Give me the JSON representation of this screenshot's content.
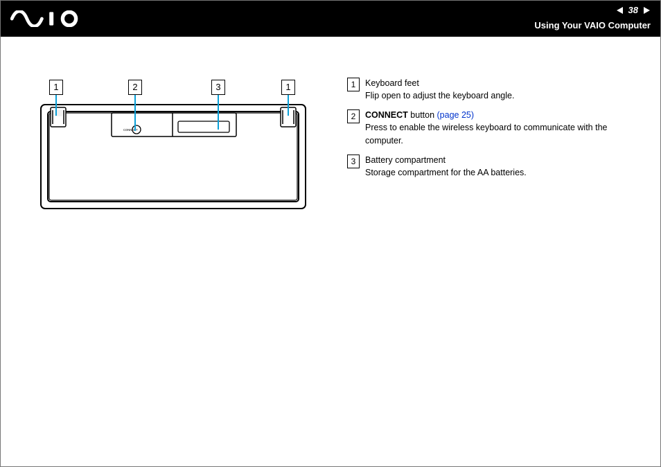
{
  "header": {
    "page_number": "38",
    "section_title": "Using Your VAIO Computer"
  },
  "callouts": {
    "c1": "1",
    "c2": "2",
    "c3": "3",
    "c4": "1"
  },
  "keyboard_label": "CONNECT",
  "legend": [
    {
      "num": "1",
      "title": "Keyboard feet",
      "desc": "Flip open to adjust the keyboard angle."
    },
    {
      "num": "2",
      "title_bold": "CONNECT",
      "title_rest": " button ",
      "link": "(page 25)",
      "desc": "Press to enable the wireless keyboard to communicate with the computer."
    },
    {
      "num": "3",
      "title": "Battery compartment",
      "desc": "Storage compartment for the AA batteries."
    }
  ]
}
